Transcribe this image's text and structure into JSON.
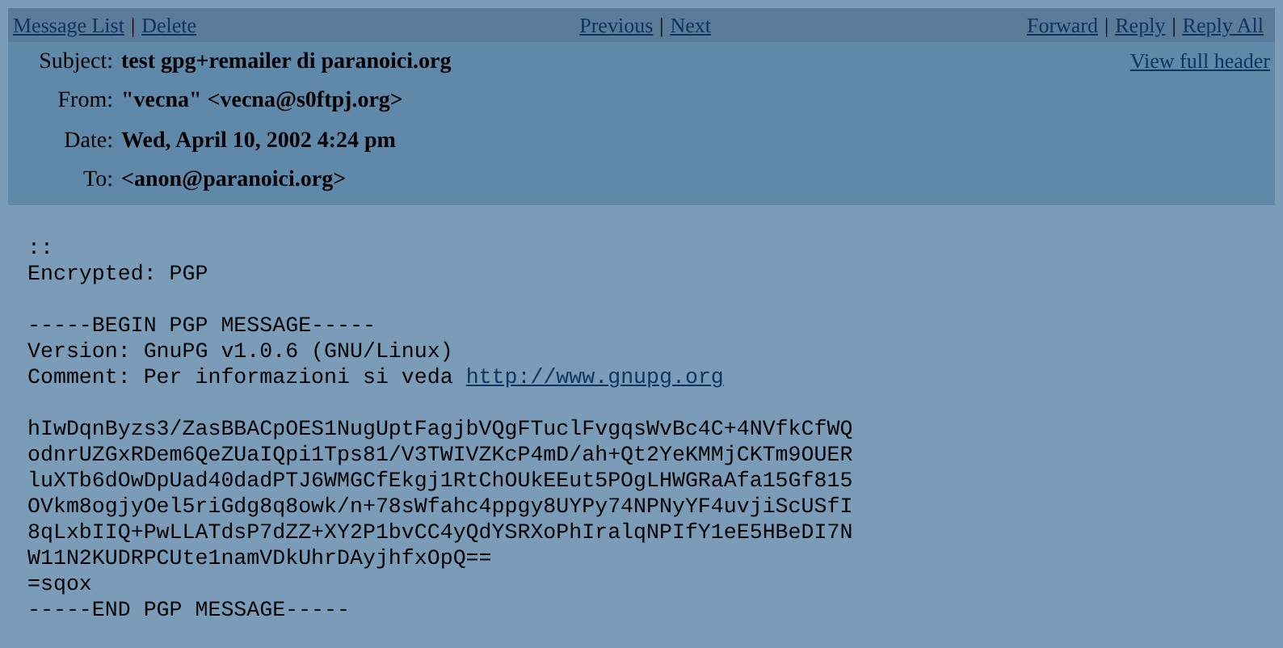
{
  "toolbar": {
    "separator": "|",
    "left": [
      "Message List",
      "Delete"
    ],
    "center": [
      "Previous",
      "Next"
    ],
    "right": [
      "Forward",
      "Reply",
      "Reply All"
    ]
  },
  "header": {
    "view_full_header": "View full header",
    "fields": [
      {
        "label": "Subject:",
        "value": "test gpg+remailer di paranoici.org"
      },
      {
        "label": "From:",
        "value": "\"vecna\" <vecna@s0ftpj.org>"
      },
      {
        "label": "Date:",
        "value": "Wed, April 10, 2002 4:24 pm"
      },
      {
        "label": "To:",
        "value": "<anon@paranoici.org>"
      }
    ]
  },
  "body": {
    "paragraphs": [
      [
        {
          "text": "::"
        },
        {
          "text": "Encrypted: PGP"
        }
      ],
      [
        {
          "text": "-----BEGIN PGP MESSAGE-----"
        },
        {
          "text": "Version: GnuPG v1.0.6 (GNU/Linux)"
        },
        {
          "text": "Comment: Per informazioni si veda",
          "link": "http://www.gnupg.org"
        }
      ],
      [
        {
          "text": "hIwDqnByzs3/ZasBBACpOES1NugUptFagjbVQgFTuclFvgqsWvBc4C+4NVfkCfWQ"
        },
        {
          "text": "odnrUZGxRDem6QeZUaIQpi1Tps81/V3TWIVZKcP4mD/ah+Qt2YeKMMjCKTm9OUER"
        },
        {
          "text": "luXTb6dOwDpUad40dadPTJ6WMGCfEkgj1RtChOUkEEut5POgLHWGRaAfa15Gf815"
        },
        {
          "text": "OVkm8ogjyOel5riGdg8q8owk/n+78sWfahc4ppgy8UYPy74NPNyYF4uvjiScUSfI"
        },
        {
          "text": "8qLxbIIQ+PwLLATdsP7dZZ+XY2P1bvCC4yQdYSRXoPhIralqNPIfY1eE5HBeDI7N"
        },
        {
          "text": "W11N2KUDRPCUte1namVDkUhrDAyjhfxOpQ=="
        },
        {
          "text": "=sqox"
        },
        {
          "text": "-----END PGP MESSAGE-----"
        }
      ]
    ]
  }
}
